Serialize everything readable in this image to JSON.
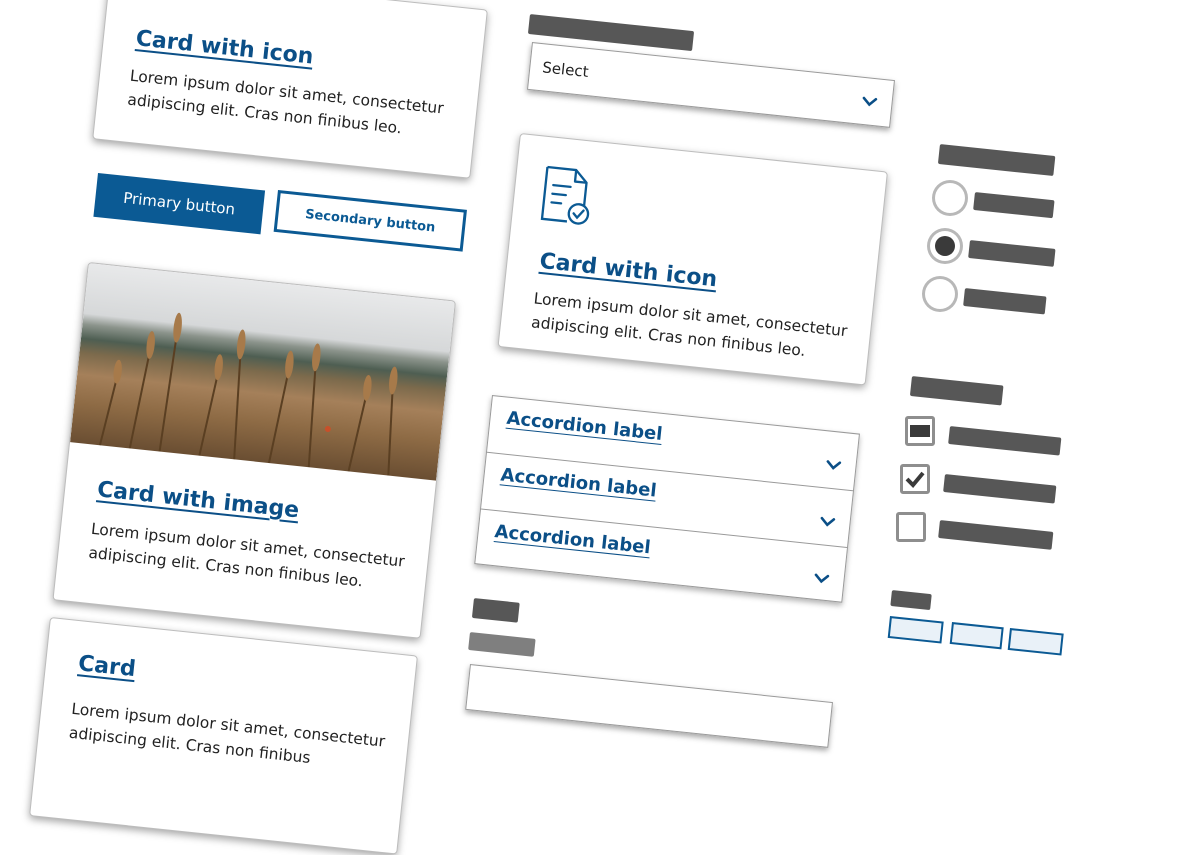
{
  "card_icon_top": {
    "title": "Card with icon",
    "text": "Lorem ipsum dolor sit amet, consectetur adipiscing elit. Cras non finibus leo."
  },
  "buttons": {
    "primary_label": "Primary button",
    "secondary_label": "Secondary button"
  },
  "card_image": {
    "title": "Card with image",
    "text": "Lorem ipsum dolor sit amet, consectetur adipiscing elit. Cras non finibus leo."
  },
  "card_plain": {
    "title": "Card",
    "text": "Lorem ipsum dolor sit amet, consectetur adipiscing elit. Cras non finibus"
  },
  "select": {
    "value": "Select"
  },
  "card_icon_mid": {
    "icon": "document-check-icon",
    "title": "Card with icon",
    "text": "Lorem ipsum dolor sit amet, consectetur adipiscing elit. Cras non finibus leo."
  },
  "accordion": {
    "items": [
      {
        "label": "Accordion label"
      },
      {
        "label": "Accordion label"
      },
      {
        "label": "Accordion label"
      }
    ]
  },
  "radios": {
    "checked_index": 1
  },
  "checkboxes": {
    "checked": [
      true,
      true,
      false
    ]
  },
  "colors": {
    "brand_blue": "#0b5a94",
    "link_blue": "#0b4f87",
    "placeholder_gray": "#3a3a3a"
  }
}
